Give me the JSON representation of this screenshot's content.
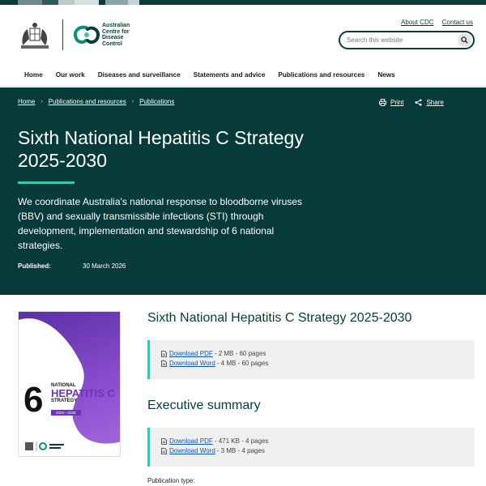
{
  "header": {
    "org_name_lines": [
      "Australian",
      "Centre for",
      "Disease",
      "Control"
    ],
    "util_links": [
      "About CDC",
      "Contact us"
    ],
    "search_placeholder": "Search this website",
    "icons": {
      "crest": "coat-of-arms-logo",
      "mark": "acdc-logo-icon",
      "search": "search-icon"
    }
  },
  "nav": {
    "items": [
      "Home",
      "Our work",
      "Diseases and surveillance",
      "Statements and advice",
      "Publications and resources",
      "News"
    ]
  },
  "hero": {
    "breadcrumb": [
      "Home",
      "Publications and resources",
      "Publications"
    ],
    "print_label": "Print",
    "share_label": "Share",
    "title": "Sixth National Hepatitis C Strategy 2025-2030",
    "lede": "We coordinate Australia's national response to bloodborne viruses (BBV) and sexually transmissible infections (STI) through development, implementation and stewardship of 6 national strategies.",
    "published_label": "Published:",
    "published_date": "30 March 2026"
  },
  "cover": {
    "number": "6",
    "line1": "NATIONAL",
    "line2": "HEPATITIS C",
    "line3": "STRATEGY",
    "years": "2025—2030"
  },
  "publication": {
    "title": "Sixth National Hepatitis C Strategy 2025-2030",
    "downloads": [
      {
        "label": "Download PDF",
        "meta": "- 2 MB - 60 pages"
      },
      {
        "label": "Download Word",
        "meta": "- 4 MB - 60 pages"
      }
    ]
  },
  "executive": {
    "title": "Executive summary",
    "downloads": [
      {
        "label": "Download PDF",
        "meta": "- 471 KB - 4 pages"
      },
      {
        "label": "Download Word",
        "meta": "- 3 MB - 4 pages"
      }
    ]
  },
  "publication_type_label": "Publication type:",
  "colors": {
    "brand": "#073b3a",
    "accent": "#3cc7a8",
    "link": "#0b55b3",
    "cover": "#6a35b8"
  }
}
